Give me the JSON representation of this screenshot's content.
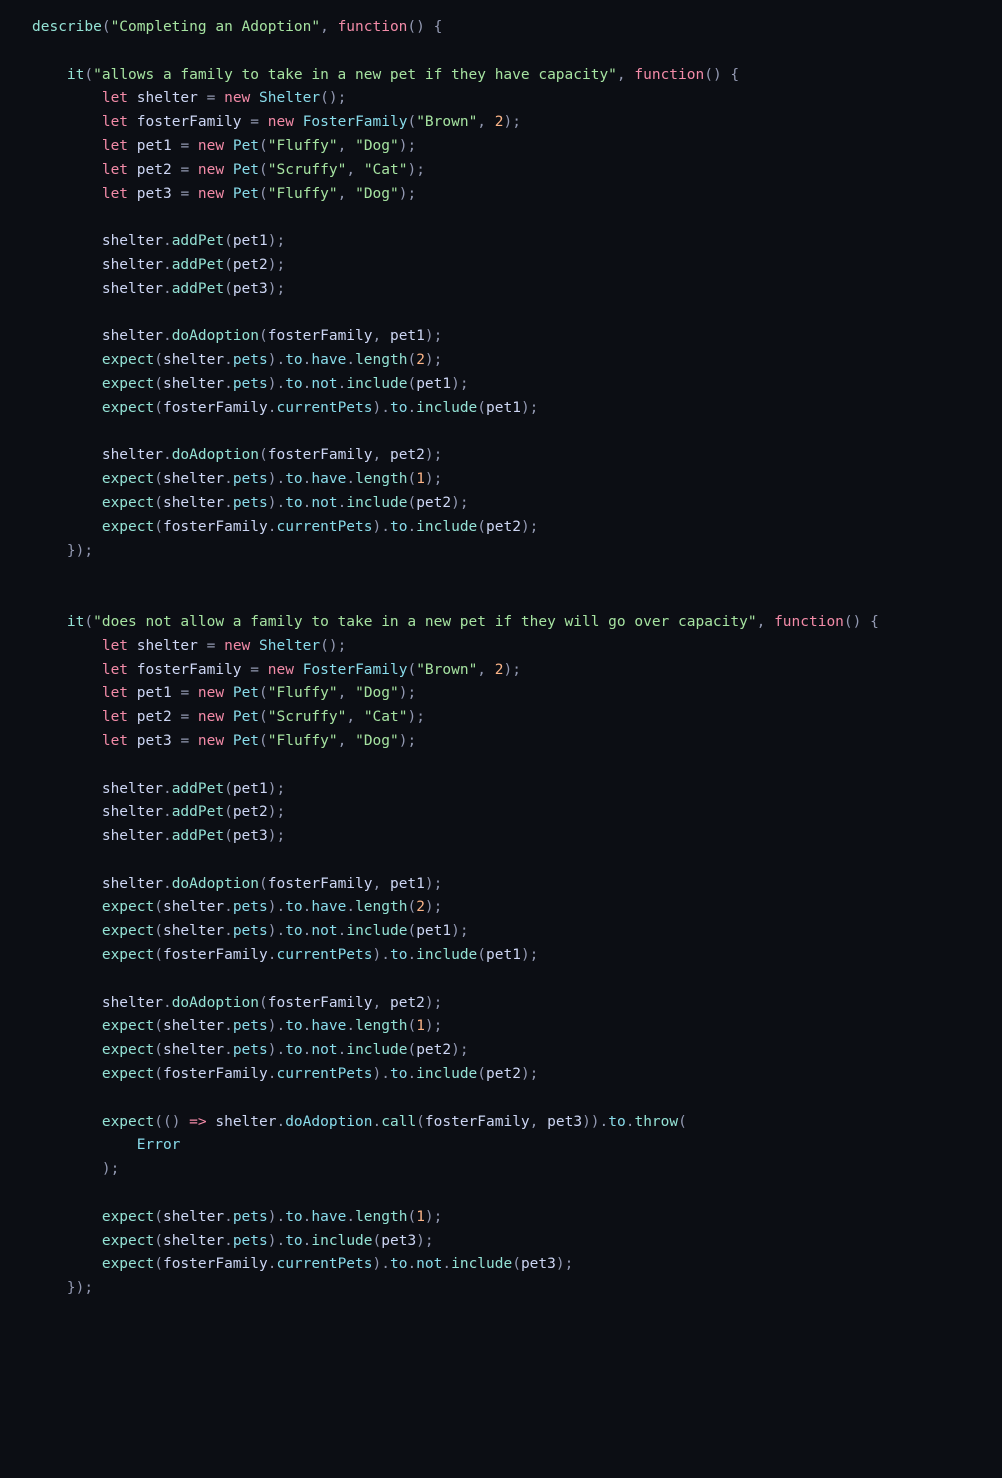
{
  "code": {
    "describeKw": "describe",
    "funcKw": "function",
    "letKw": "let",
    "newKw": "new",
    "errorKw": "Error",
    "arrow": "=>",
    "describeLabel": "\"Completing an Adoption\"",
    "it1Label": "\"allows a family to take in a new pet if they have capacity\"",
    "it2Label": "\"does not allow a family to take in a new pet if they will go over capacity\"",
    "shelterVar": "shelter",
    "fosterFamilyVar": "fosterFamily",
    "pet1Var": "pet1",
    "pet2Var": "pet2",
    "pet3Var": "pet3",
    "ShelterType": "Shelter",
    "FosterFamilyType": "FosterFamily",
    "PetType": "Pet",
    "brownStr": "\"Brown\"",
    "fluffyStr": "\"Fluffy\"",
    "dogStr": "\"Dog\"",
    "scruffyStr": "\"Scruffy\"",
    "catStr": "\"Cat\"",
    "num1": "1",
    "num2": "2",
    "addPet": "addPet",
    "doAdoption": "doAdoption",
    "expectFn": "expect",
    "petsProp": "pets",
    "currentPetsProp": "currentPets",
    "toProp": "to",
    "haveProp": "have",
    "notProp": "not",
    "lengthFn": "length",
    "includeFn": "include",
    "callFn": "call",
    "throwFn": "throw",
    "itFn": "it"
  }
}
